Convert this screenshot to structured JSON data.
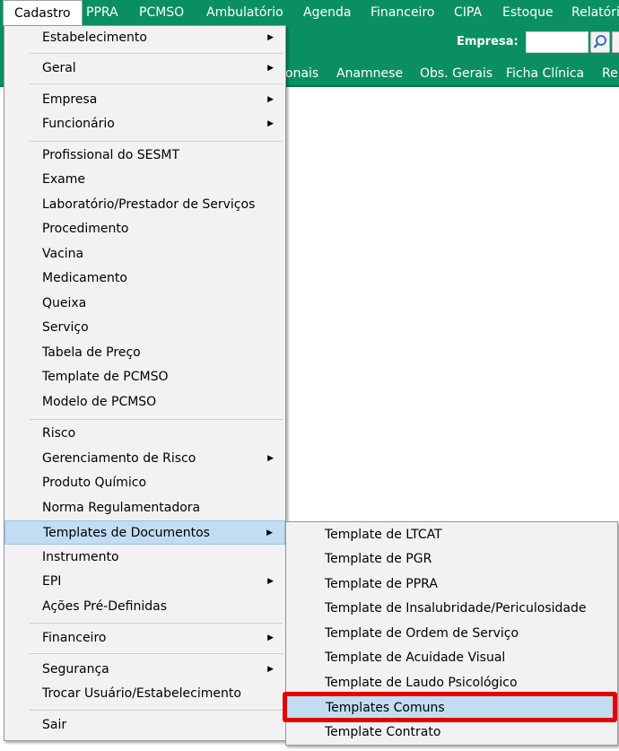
{
  "menubar": {
    "items": [
      "Cadastro",
      "PPRA",
      "PCMSO",
      "Ambulatório",
      "Agenda",
      "Financeiro",
      "CIPA",
      "Estoque",
      "Relatório"
    ]
  },
  "toolbar": {
    "empresa_label": "Empresa:",
    "empresa_value": ""
  },
  "tabs": [
    "onais",
    "Anamnese",
    "Obs. Gerais",
    "Ficha Clínica",
    "Re"
  ],
  "menu": {
    "items": [
      {
        "label": "Estabelecimento",
        "submenu": true
      },
      {
        "label": "Geral",
        "submenu": true
      },
      {
        "label": "Empresa",
        "submenu": true
      },
      {
        "label": "Funcionário",
        "submenu": true
      },
      {
        "label": "Profissional do SESMT",
        "submenu": false
      },
      {
        "label": "Exame",
        "submenu": false
      },
      {
        "label": "Laboratório/Prestador de Serviços",
        "submenu": false
      },
      {
        "label": "Procedimento",
        "submenu": false
      },
      {
        "label": "Vacina",
        "submenu": false
      },
      {
        "label": "Medicamento",
        "submenu": false
      },
      {
        "label": "Queixa",
        "submenu": false
      },
      {
        "label": "Serviço",
        "submenu": false
      },
      {
        "label": "Tabela de Preço",
        "submenu": false
      },
      {
        "label": "Template de PCMSO",
        "submenu": false
      },
      {
        "label": "Modelo de PCMSO",
        "submenu": false
      },
      {
        "label": "Risco",
        "submenu": false
      },
      {
        "label": "Gerenciamento de Risco",
        "submenu": true
      },
      {
        "label": "Produto Químico",
        "submenu": false
      },
      {
        "label": "Norma Regulamentadora",
        "submenu": false
      },
      {
        "label": "Templates de Documentos",
        "submenu": true
      },
      {
        "label": "Instrumento",
        "submenu": false
      },
      {
        "label": "EPI",
        "submenu": true
      },
      {
        "label": "Ações Pré-Definidas",
        "submenu": false
      },
      {
        "label": "Financeiro",
        "submenu": true
      },
      {
        "label": "Segurança",
        "submenu": true
      },
      {
        "label": "Trocar Usuário/Estabelecimento",
        "submenu": false
      },
      {
        "label": "Sair",
        "submenu": false
      }
    ]
  },
  "submenu": {
    "items": [
      "Template de LTCAT",
      "Template de PGR",
      "Template de PPRA",
      "Template de Insalubridade/Periculosidade",
      "Template de Ordem de Serviço",
      "Template de Acuidade Visual",
      "Template de Laudo Psicológico",
      "Templates Comuns",
      "Template Contrato"
    ]
  },
  "colors": {
    "app_green": "#0a8f62",
    "menu_background": "#f2f2f2",
    "highlight": "#c2dcf2",
    "annotation_red": "#e60000"
  }
}
